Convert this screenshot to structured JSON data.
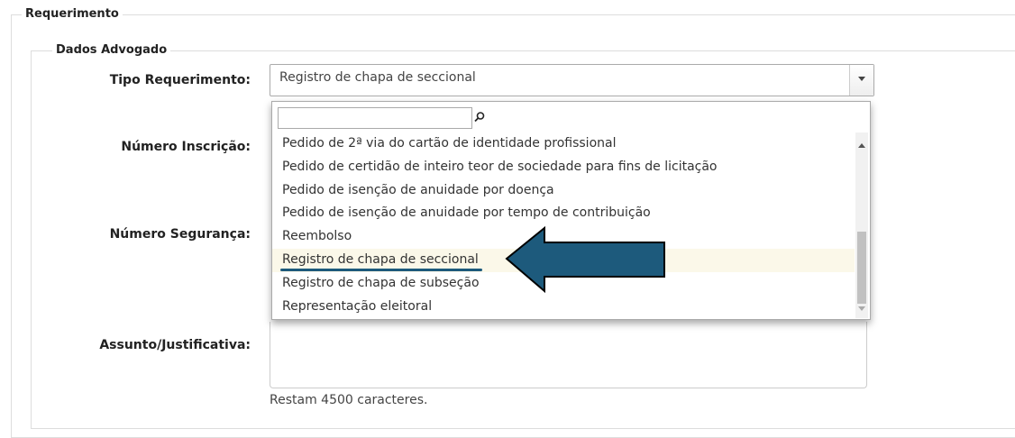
{
  "sections": {
    "outer_legend": "Requerimento",
    "inner_legend": "Dados Advogado"
  },
  "labels": {
    "tipo_requerimento": "Tipo Requerimento:",
    "numero_inscricao": "Número Inscrição:",
    "numero_seguranca": "Número Segurança:",
    "assunto": "Assunto/Justificativa:"
  },
  "select": {
    "value": "Registro de chapa de seccional"
  },
  "dropdown": {
    "search_value": "",
    "selected_index": 5,
    "options": [
      "Pedido de 2ª via do cartão de identidade profissional",
      "Pedido de certidão de inteiro teor de sociedade para fins de licitação",
      "Pedido de isenção de anuidade por doença",
      "Pedido de isenção de anuidade por tempo de contribuição",
      "Reembolso",
      "Registro de chapa de seccional",
      "Registro de chapa de subseção",
      "Representação eleitoral"
    ]
  },
  "textarea": {
    "value": "",
    "hint": "Restam 4500 caracteres."
  },
  "colors": {
    "annotation_arrow": "#1d5a7c",
    "selected_option_bg": "#fbf8e9"
  }
}
